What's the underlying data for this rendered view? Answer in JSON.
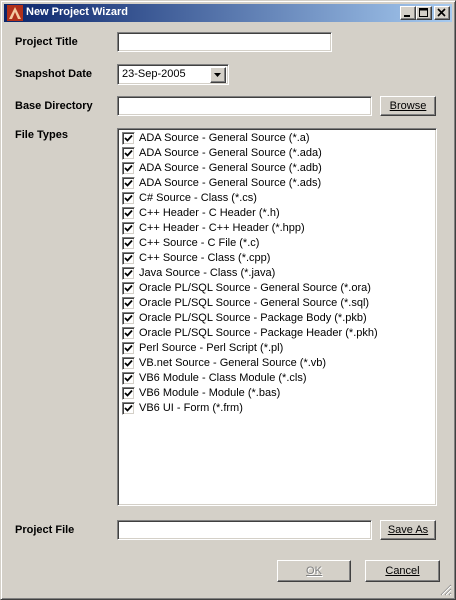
{
  "window": {
    "title": "New Project Wizard",
    "app_icon": "app-logo-icon",
    "controls": [
      "minimize-icon",
      "maximize-icon",
      "close-icon"
    ]
  },
  "form": {
    "project_title": {
      "label": "Project Title",
      "value": ""
    },
    "snapshot_date": {
      "label": "Snapshot Date",
      "value": "23-Sep-2005",
      "icon": "chevron-down-icon"
    },
    "base_directory": {
      "label": "Base Directory",
      "value": "",
      "browse_label": "Browse"
    },
    "file_types": {
      "label": "File Types",
      "items": [
        {
          "label": "ADA Source - General Source (*.a)",
          "checked": true
        },
        {
          "label": "ADA Source - General Source (*.ada)",
          "checked": true
        },
        {
          "label": "ADA Source - General Source (*.adb)",
          "checked": true
        },
        {
          "label": "ADA Source - General Source (*.ads)",
          "checked": true
        },
        {
          "label": "C# Source - Class (*.cs)",
          "checked": true
        },
        {
          "label": "C++ Header - C Header (*.h)",
          "checked": true
        },
        {
          "label": "C++ Header - C++ Header (*.hpp)",
          "checked": true
        },
        {
          "label": "C++ Source - C File (*.c)",
          "checked": true
        },
        {
          "label": "C++ Source - Class (*.cpp)",
          "checked": true
        },
        {
          "label": "Java Source - Class (*.java)",
          "checked": true
        },
        {
          "label": "Oracle PL/SQL Source - General Source (*.ora)",
          "checked": true
        },
        {
          "label": "Oracle PL/SQL Source - General Source (*.sql)",
          "checked": true
        },
        {
          "label": "Oracle PL/SQL Source - Package Body (*.pkb)",
          "checked": true
        },
        {
          "label": "Oracle PL/SQL Source - Package Header (*.pkh)",
          "checked": true
        },
        {
          "label": "Perl Source - Perl Script (*.pl)",
          "checked": true
        },
        {
          "label": "VB.net Source - General Source (*.vb)",
          "checked": true
        },
        {
          "label": "VB6 Module - Class Module (*.cls)",
          "checked": true
        },
        {
          "label": "VB6 Module - Module (*.bas)",
          "checked": true
        },
        {
          "label": "VB6 UI - Form (*.frm)",
          "checked": true
        }
      ]
    },
    "project_file": {
      "label": "Project File",
      "value": "",
      "save_as_label": "Save As"
    }
  },
  "buttons": {
    "ok_label": "OK",
    "ok_enabled": false,
    "cancel_label": "Cancel"
  },
  "colors": {
    "titlebar_start": "#0a246a",
    "titlebar_end": "#a6caf0",
    "face": "#d4d0c8"
  }
}
